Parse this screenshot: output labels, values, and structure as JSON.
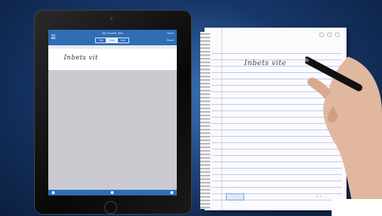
{
  "ipad_app": {
    "top_bar": {
      "title": "My Favorite Idea",
      "segment_tabs": [
        "Text",
        "Draw",
        "Both"
      ],
      "selected_tab": "Draw",
      "right_top": "Done",
      "right_button": "Share"
    },
    "handwriting_text": "Inbets vit"
  },
  "notepad": {
    "handwriting_text": "Inbets vite"
  },
  "icons": [
    "menu-icon",
    "pen-icon",
    "trash-icon",
    "share-icon",
    "camera-icon",
    "home-button",
    "spiral-binding"
  ]
}
